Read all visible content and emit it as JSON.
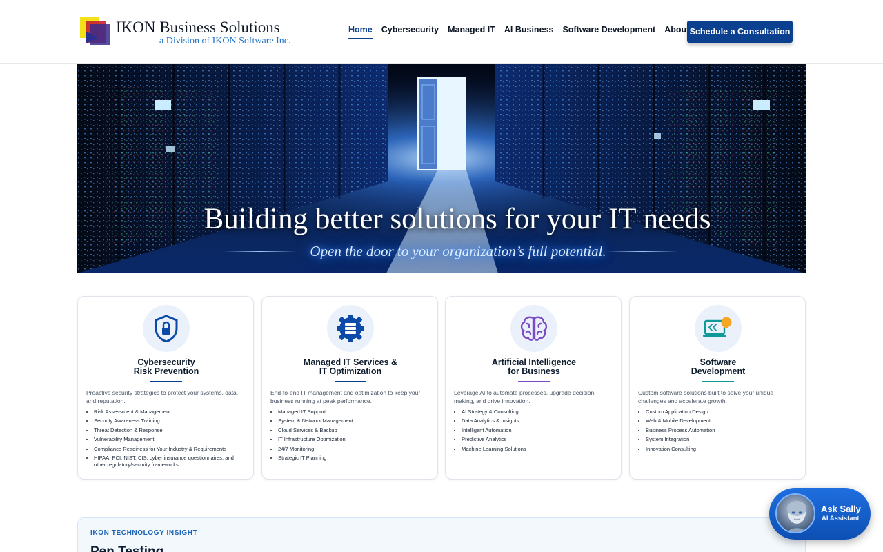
{
  "header": {
    "logo_title": "IKON Business Solutions",
    "logo_subtitle": "a Division of IKON Software Inc.",
    "nav": [
      {
        "label": "Home",
        "active": true
      },
      {
        "label": "Cybersecurity",
        "active": false
      },
      {
        "label": "Managed IT",
        "active": false
      },
      {
        "label": "AI Business",
        "active": false
      },
      {
        "label": "Software Development",
        "active": false
      },
      {
        "label": "About",
        "active": false
      }
    ],
    "cta_label": "Schedule a Consultation"
  },
  "hero": {
    "title": "Building better solutions for your IT needs",
    "subtitle": "Open the door to your organization’s full potential."
  },
  "cards": [
    {
      "icon": "shield-lock-icon",
      "title": "Cybersecurity\nRisk Prevention",
      "accent": "#0b3f8f",
      "description": "Proactive security strategies to protect your systems, data, and reputation.",
      "items": [
        "Risk Assessment & Management",
        "Security Awareness Training",
        "Threat Detection & Response",
        "Vulnerability Management",
        "Compliance Readiness for Your Industry & Requirements",
        "HIPAA, PCI, NIST, CIS, cyber insurance questionnaires, and other regulatory/security frameworks."
      ]
    },
    {
      "icon": "server-gear-icon",
      "title": "Managed IT Services &\nIT Optimization",
      "accent": "#0b3f8f",
      "description": "End-to-end IT management and optimization to keep your business running at peak performance.",
      "items": [
        "Managed IT Support",
        "System & Network Management",
        "Cloud Services & Backup",
        "IT Infrastructure Optimization",
        "24/7 Monitoring",
        "Strategic IT Planning"
      ]
    },
    {
      "icon": "brain-icon",
      "title": "Artificial Intelligence\nfor Business",
      "accent": "#7b4bc4",
      "description": "Leverage AI to automate processes, upgrade decision-making, and drive innovation.",
      "items": [
        "AI Strategy & Consulting",
        "Data Analytics & Insights",
        "Intelligent Automation",
        "Predictive Analytics",
        "Machine Learning Solutions"
      ]
    },
    {
      "icon": "code-laptop-icon",
      "title": "Software\nDevelopment",
      "accent": "#0f9a9a",
      "description": "Custom software solutions built to solve your unique challenges and accelerate growth.",
      "items": [
        "Custom Application Design",
        "Web & Mobile Development",
        "Business Process Automation",
        "System Integration",
        "Innovation Consulting"
      ]
    }
  ],
  "insight": {
    "eyebrow": "IKON TECHNOLOGY INSIGHT",
    "title": "Pen Testing"
  },
  "assistant": {
    "name": "Ask Sally",
    "role": "AI Assistant"
  }
}
